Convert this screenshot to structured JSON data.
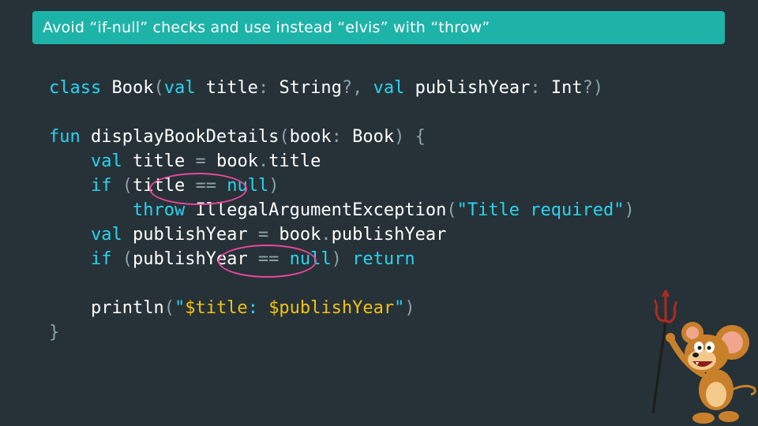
{
  "slide": {
    "title": "Avoid “if-null” checks and use instead “elvis” with “throw”"
  },
  "code": {
    "lines": [
      [
        {
          "t": "class ",
          "k": "kw"
        },
        {
          "t": "Book",
          "k": "tx"
        },
        {
          "t": "(",
          "k": "pu"
        },
        {
          "t": "val ",
          "k": "kw"
        },
        {
          "t": "title",
          "k": "tx"
        },
        {
          "t": ": ",
          "k": "pu"
        },
        {
          "t": "String",
          "k": "tx"
        },
        {
          "t": "?, ",
          "k": "pu"
        },
        {
          "t": "val ",
          "k": "kw"
        },
        {
          "t": "publishYear",
          "k": "tx"
        },
        {
          "t": ": ",
          "k": "pu"
        },
        {
          "t": "Int",
          "k": "tx"
        },
        {
          "t": "?)",
          "k": "pu"
        }
      ],
      [],
      [
        {
          "t": "fun ",
          "k": "kw"
        },
        {
          "t": "displayBookDetails",
          "k": "tx"
        },
        {
          "t": "(",
          "k": "pu"
        },
        {
          "t": "book",
          "k": "tx"
        },
        {
          "t": ": ",
          "k": "pu"
        },
        {
          "t": "Book",
          "k": "tx"
        },
        {
          "t": ") {",
          "k": "pu"
        }
      ],
      [
        {
          "t": "    val ",
          "k": "kw"
        },
        {
          "t": "title ",
          "k": "tx"
        },
        {
          "t": "= ",
          "k": "pu"
        },
        {
          "t": "book",
          "k": "tx"
        },
        {
          "t": ".",
          "k": "pu"
        },
        {
          "t": "title",
          "k": "tx"
        }
      ],
      [
        {
          "t": "    if ",
          "k": "kw"
        },
        {
          "t": "(",
          "k": "pu"
        },
        {
          "t": "title ",
          "k": "tx"
        },
        {
          "t": "== ",
          "k": "pu"
        },
        {
          "t": "null",
          "k": "kw"
        },
        {
          "t": ")",
          "k": "pu"
        }
      ],
      [
        {
          "t": "        throw ",
          "k": "kw"
        },
        {
          "t": "IllegalArgumentException",
          "k": "tx"
        },
        {
          "t": "(",
          "k": "pu"
        },
        {
          "t": "\"Title required\"",
          "k": "st"
        },
        {
          "t": ")",
          "k": "pu"
        }
      ],
      [
        {
          "t": "    val ",
          "k": "kw"
        },
        {
          "t": "publishYear ",
          "k": "tx"
        },
        {
          "t": "= ",
          "k": "pu"
        },
        {
          "t": "book",
          "k": "tx"
        },
        {
          "t": ".",
          "k": "pu"
        },
        {
          "t": "publishYear",
          "k": "tx"
        }
      ],
      [
        {
          "t": "    if ",
          "k": "kw"
        },
        {
          "t": "(",
          "k": "pu"
        },
        {
          "t": "publishYear ",
          "k": "tx"
        },
        {
          "t": "== ",
          "k": "pu"
        },
        {
          "t": "null",
          "k": "kw"
        },
        {
          "t": ") ",
          "k": "pu"
        },
        {
          "t": "return",
          "k": "kw"
        }
      ],
      [],
      [
        {
          "t": "    println",
          "k": "tx"
        },
        {
          "t": "(",
          "k": "pu"
        },
        {
          "t": "\"",
          "k": "st"
        },
        {
          "t": "$title",
          "k": "tp"
        },
        {
          "t": ": ",
          "k": "st"
        },
        {
          "t": "$publishYear",
          "k": "tp"
        },
        {
          "t": "\"",
          "k": "st"
        },
        {
          "t": ")",
          "k": "pu"
        }
      ],
      [
        {
          "t": "}",
          "k": "pu"
        }
      ]
    ]
  },
  "annotations": {
    "oval_color": "#e8489a",
    "ovals": [
      "title-null-check",
      "publishYear-null-check"
    ]
  },
  "colors": {
    "background": "#263238",
    "title_bar": "#1eb3a8",
    "keyword": "#29d4ef",
    "punctuation": "#8ea2aa",
    "template": "#f4c20d"
  },
  "mascot": {
    "icon": "cartoon-mouse-with-trident"
  }
}
